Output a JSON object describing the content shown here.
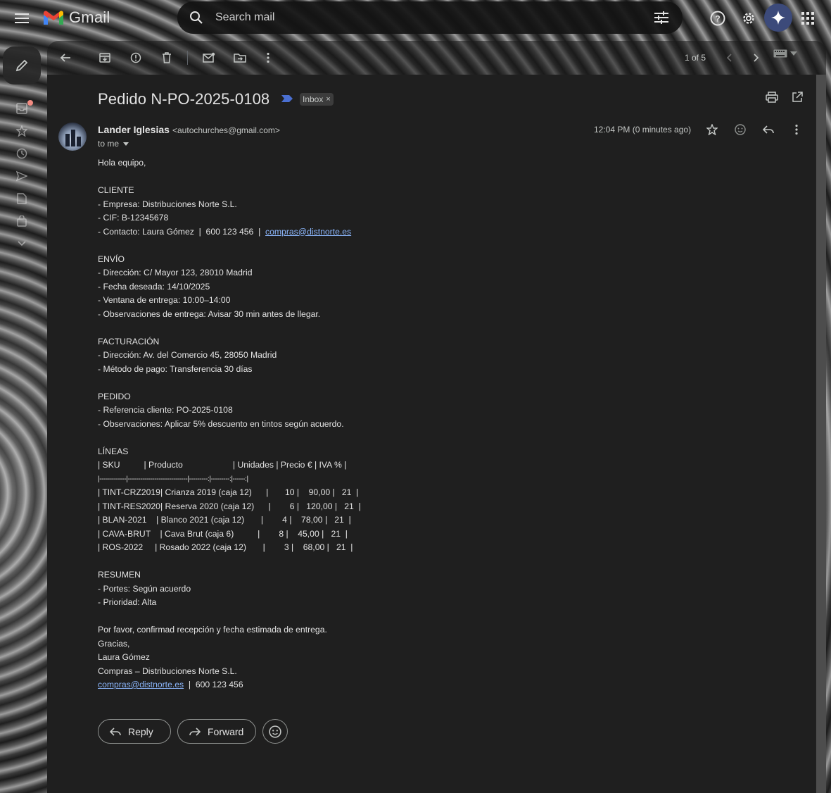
{
  "app": {
    "name": "Gmail"
  },
  "search": {
    "placeholder": "Search mail"
  },
  "toolbar": {
    "pager": "1 of 5"
  },
  "email": {
    "subject": "Pedido N-PO-2025-0108",
    "label": "Inbox",
    "sender_name": "Lander Iglesias",
    "sender_email": "<autochurches@gmail.com>",
    "to": "to me",
    "time": "12:04 PM (0 minutes ago)",
    "greeting": "Hola equipo,",
    "cliente": {
      "heading": "CLIENTE",
      "empresa": "- Empresa: Distribuciones Norte S.L.",
      "cif": "- CIF: B-12345678",
      "contacto_prefix": "- Contacto: Laura Gómez  |  600 123 456  |  ",
      "contacto_email": "compras@distnorte.es"
    },
    "envio": {
      "heading": "ENVÍO",
      "direccion": "- Dirección: C/ Mayor 123, 28010 Madrid",
      "fecha": "- Fecha deseada: 14/10/2025",
      "ventana": "- Ventana de entrega: 10:00–14:00",
      "observaciones": "- Observaciones de entrega: Avisar 30 min antes de llegar."
    },
    "facturacion": {
      "heading": "FACTURACIÓN",
      "direccion": "- Dirección: Av. del Comercio 45, 28050 Madrid",
      "metodo": "- Método de pago: Transferencia 30 días"
    },
    "pedido": {
      "heading": "PEDIDO",
      "referencia": "- Referencia cliente: PO-2025-0108",
      "observaciones": "- Observaciones: Aplicar 5% descuento en tintos según acuerdo."
    },
    "lineas": {
      "heading": "LÍNEAS",
      "header": "| SKU          | Producto                     | Unidades | Precio € | IVA % |",
      "separator": "|-------------|-----------------------------|---------:|---------:|------:|",
      "rows": [
        "| TINT-CRZ2019| Crianza 2019 (caja 12)      |       10 |    90,00 |   21  |",
        "| TINT-RES2020| Reserva 2020 (caja 12)      |        6 |   120,00 |   21  |",
        "| BLAN-2021    | Blanco 2021 (caja 12)       |        4 |    78,00 |   21  |",
        "| CAVA-BRUT    | Cava Brut (caja 6)          |        8 |    45,00 |   21  |",
        "| ROS-2022     | Rosado 2022 (caja 12)       |        3 |    68,00 |   21  |"
      ]
    },
    "resumen": {
      "heading": "RESUMEN",
      "portes": "- Portes: Según acuerdo",
      "prioridad": "- Prioridad: Alta"
    },
    "closing": {
      "request": "Por favor, confirmad recepción y fecha estimada de entrega.",
      "thanks": "Gracias,",
      "name": "Laura Gómez",
      "company": "Compras – Distribuciones Norte S.L.",
      "email": "compras@distnorte.es",
      "phone_suffix": "  |  600 123 456"
    }
  },
  "actions": {
    "reply": "Reply",
    "forward": "Forward"
  },
  "colors": {
    "accent_link": "#8ab4f8",
    "gemini": "#3c4a7a",
    "notification": "#f28b82"
  }
}
